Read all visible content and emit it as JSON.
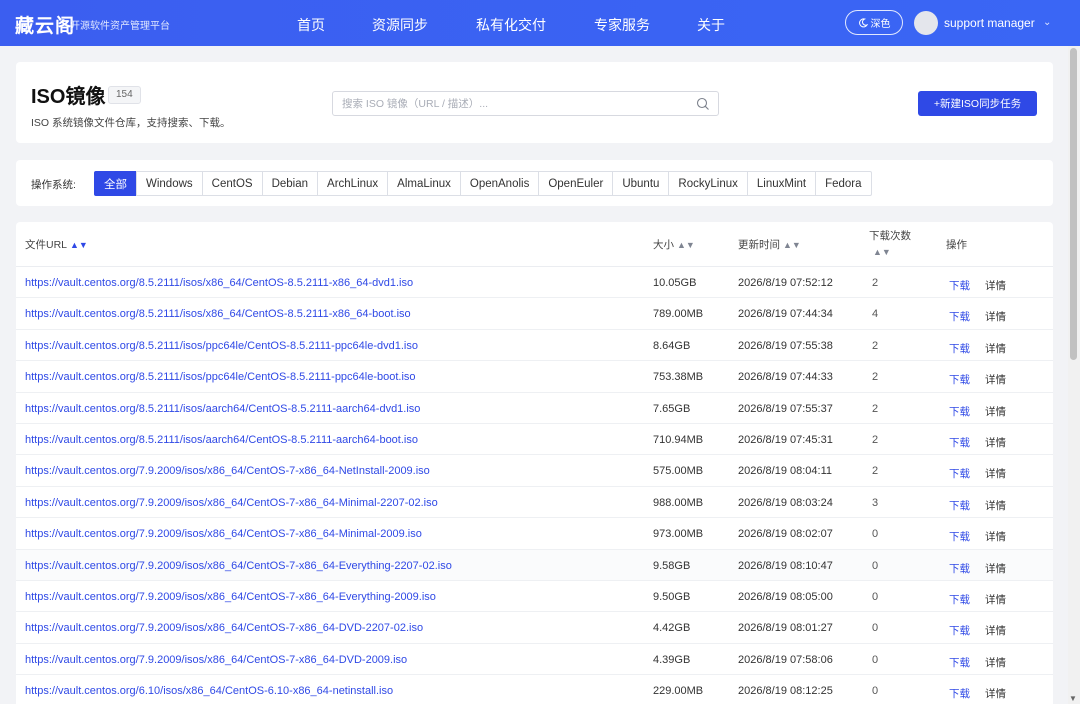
{
  "header": {
    "brand": "藏云阁",
    "brand_sub": "开源软件资产管理平台",
    "nav": [
      "首页",
      "资源同步",
      "私有化交付",
      "专家服务",
      "关于"
    ],
    "theme_label": "深色",
    "user_name": "support manager"
  },
  "page": {
    "title": "ISO镜像",
    "count": "154",
    "subtitle": "ISO 系统镜像文件仓库，支持搜索、下载。",
    "search_placeholder": "搜索 ISO 镜像（URL / 描述）...",
    "new_button": "+新建ISO同步任务"
  },
  "filter": {
    "label": "操作系统:",
    "options": [
      "全部",
      "Windows",
      "CentOS",
      "Debian",
      "ArchLinux",
      "AlmaLinux",
      "OpenAnolis",
      "OpenEuler",
      "Ubuntu",
      "RockyLinux",
      "LinuxMint",
      "Fedora"
    ],
    "selected": "全部"
  },
  "table": {
    "headers": {
      "url": "文件URL",
      "size": "大小",
      "time": "更新时间",
      "downloads_line1": "下载次数",
      "ops": "操作"
    },
    "op_download": "下载",
    "op_detail": "详情",
    "rows": [
      {
        "url": "https://vault.centos.org/8.5.2111/isos/x86_64/CentOS-8.5.2111-x86_64-dvd1.iso",
        "size": "10.05GB",
        "time": "2026/8/19 07:52:12",
        "downloads": "2"
      },
      {
        "url": "https://vault.centos.org/8.5.2111/isos/x86_64/CentOS-8.5.2111-x86_64-boot.iso",
        "size": "789.00MB",
        "time": "2026/8/19 07:44:34",
        "downloads": "4"
      },
      {
        "url": "https://vault.centos.org/8.5.2111/isos/ppc64le/CentOS-8.5.2111-ppc64le-dvd1.iso",
        "size": "8.64GB",
        "time": "2026/8/19 07:55:38",
        "downloads": "2"
      },
      {
        "url": "https://vault.centos.org/8.5.2111/isos/ppc64le/CentOS-8.5.2111-ppc64le-boot.iso",
        "size": "753.38MB",
        "time": "2026/8/19 07:44:33",
        "downloads": "2"
      },
      {
        "url": "https://vault.centos.org/8.5.2111/isos/aarch64/CentOS-8.5.2111-aarch64-dvd1.iso",
        "size": "7.65GB",
        "time": "2026/8/19 07:55:37",
        "downloads": "2"
      },
      {
        "url": "https://vault.centos.org/8.5.2111/isos/aarch64/CentOS-8.5.2111-aarch64-boot.iso",
        "size": "710.94MB",
        "time": "2026/8/19 07:45:31",
        "downloads": "2"
      },
      {
        "url": "https://vault.centos.org/7.9.2009/isos/x86_64/CentOS-7-x86_64-NetInstall-2009.iso",
        "size": "575.00MB",
        "time": "2026/8/19 08:04:11",
        "downloads": "2"
      },
      {
        "url": "https://vault.centos.org/7.9.2009/isos/x86_64/CentOS-7-x86_64-Minimal-2207-02.iso",
        "size": "988.00MB",
        "time": "2026/8/19 08:03:24",
        "downloads": "3"
      },
      {
        "url": "https://vault.centos.org/7.9.2009/isos/x86_64/CentOS-7-x86_64-Minimal-2009.iso",
        "size": "973.00MB",
        "time": "2026/8/19 08:02:07",
        "downloads": "0"
      },
      {
        "url": "https://vault.centos.org/7.9.2009/isos/x86_64/CentOS-7-x86_64-Everything-2207-02.iso",
        "size": "9.58GB",
        "time": "2026/8/19 08:10:47",
        "downloads": "0"
      },
      {
        "url": "https://vault.centos.org/7.9.2009/isos/x86_64/CentOS-7-x86_64-Everything-2009.iso",
        "size": "9.50GB",
        "time": "2026/8/19 08:05:00",
        "downloads": "0"
      },
      {
        "url": "https://vault.centos.org/7.9.2009/isos/x86_64/CentOS-7-x86_64-DVD-2207-02.iso",
        "size": "4.42GB",
        "time": "2026/8/19 08:01:27",
        "downloads": "0"
      },
      {
        "url": "https://vault.centos.org/7.9.2009/isos/x86_64/CentOS-7-x86_64-DVD-2009.iso",
        "size": "4.39GB",
        "time": "2026/8/19 07:58:06",
        "downloads": "0"
      },
      {
        "url": "https://vault.centos.org/6.10/isos/x86_64/CentOS-6.10-x86_64-netinstall.iso",
        "size": "229.00MB",
        "time": "2026/8/19 08:12:25",
        "downloads": "0"
      }
    ]
  },
  "colors": {
    "primary": "#2f49e6",
    "header_bg": "#3b5ef0",
    "page_bg": "#f2f3f6"
  }
}
